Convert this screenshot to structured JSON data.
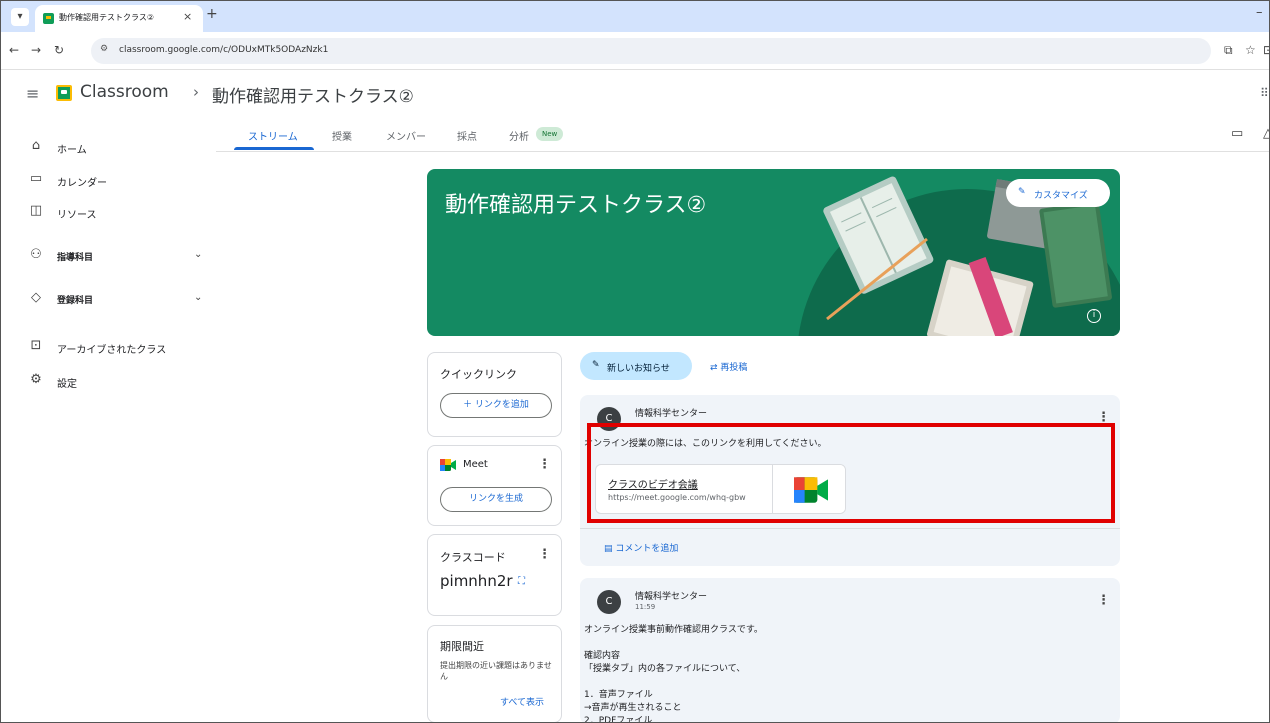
{
  "browser": {
    "tab_title": "動作確認用テストクラス②",
    "tab_close": "×",
    "new_tab": "+",
    "minimize": "–",
    "url": "classroom.google.com/c/ODUxMTk5ODAzNzk1"
  },
  "header": {
    "app_name": "Classroom",
    "breadcrumb_sep": "›",
    "class_name": "動作確認用テストクラス②"
  },
  "sidebar": {
    "items": [
      {
        "label": "ホーム",
        "icon": "home-icon"
      },
      {
        "label": "カレンダー",
        "icon": "calendar-icon"
      },
      {
        "label": "リソース",
        "icon": "resources-icon"
      },
      {
        "label": "指導科目",
        "icon": "teaching-icon"
      },
      {
        "label": "登録科目",
        "icon": "enrolled-icon"
      },
      {
        "label": "アーカイブされたクラス",
        "icon": "archive-icon"
      },
      {
        "label": "設定",
        "icon": "settings-icon"
      }
    ]
  },
  "tabs": [
    {
      "label": "ストリーム",
      "active": true
    },
    {
      "label": "授業",
      "active": false
    },
    {
      "label": "メンバー",
      "active": false
    },
    {
      "label": "採点",
      "active": false
    },
    {
      "label": "分析",
      "active": false
    }
  ],
  "new_badge": "New",
  "banner": {
    "title": "動作確認用テストクラス②",
    "customize_label": "カスタマイズ",
    "color": "#148a62"
  },
  "quick_links": {
    "title": "クイックリンク",
    "add_label": "＋ リンクを追加"
  },
  "meet": {
    "title": "Meet",
    "generate_label": "リンクを生成"
  },
  "class_code": {
    "title": "クラスコード",
    "code": "pimnhn2r"
  },
  "upcoming": {
    "title": "期限間近",
    "text": "提出期限の近い課題はありません",
    "view_all": "すべて表示"
  },
  "stream": {
    "announce_label": "新しいお知らせ",
    "repost_label": "再投稿",
    "posts": [
      {
        "avatar": "C",
        "author": "情報科学センター",
        "body": "オンライン授業の際には、このリンクを利用してください。",
        "attachment_title": "クラスのビデオ会議",
        "attachment_url": "https://meet.google.com/whq-gbw",
        "comment_label": "コメントを追加"
      },
      {
        "avatar": "C",
        "author": "情報科学センター",
        "time": "11:59",
        "lines": [
          "オンライン授業事前動作確認用クラスです。",
          "",
          "確認内容",
          "「授業タブ」内の各ファイルについて、",
          "",
          "1．音声ファイル",
          "→音声が再生されること",
          "2．PDFファイル"
        ]
      }
    ]
  },
  "colors": {
    "accent": "#1967d2",
    "highlight": "#e00000"
  }
}
